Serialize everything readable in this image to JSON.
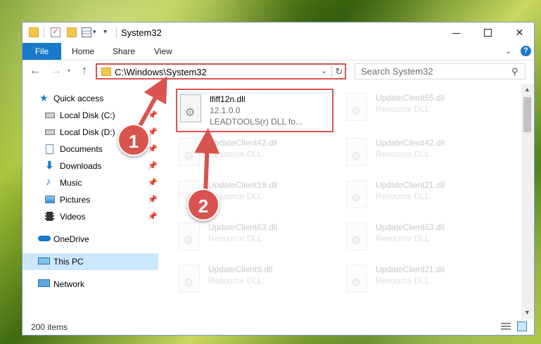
{
  "window": {
    "title": "System32"
  },
  "ribbon": {
    "tabs": [
      "File",
      "Home",
      "Share",
      "View"
    ]
  },
  "address": {
    "path": "C:\\Windows\\System32"
  },
  "search": {
    "placeholder": "Search System32"
  },
  "sidebar": {
    "items": [
      {
        "label": "Quick access",
        "icon": "star-icon"
      },
      {
        "label": "Local Disk (C:)",
        "icon": "drive-icon",
        "pinned": true
      },
      {
        "label": "Local Disk (D:)",
        "icon": "drive-icon",
        "pinned": true
      },
      {
        "label": "Documents",
        "icon": "documents-icon",
        "pinned": true
      },
      {
        "label": "Downloads",
        "icon": "download-icon",
        "pinned": true
      },
      {
        "label": "Music",
        "icon": "music-icon",
        "pinned": true
      },
      {
        "label": "Pictures",
        "icon": "pictures-icon",
        "pinned": true
      },
      {
        "label": "Videos",
        "icon": "videos-icon",
        "pinned": true
      },
      {
        "label": "OneDrive",
        "icon": "cloud-icon"
      },
      {
        "label": "This PC",
        "icon": "computer-icon",
        "selected": true
      },
      {
        "label": "Network",
        "icon": "network-icon"
      }
    ]
  },
  "files": [
    {
      "name": "lfiff12n.dll",
      "line2": "12.1.0.0",
      "line3": "LEADTOOLS(r) DLL fo...",
      "highlighted": true
    },
    {
      "name": "UpdateClient65.dll",
      "line2": "Resource DLL"
    },
    {
      "name": "UpdateClient42.dll",
      "line2": "Resource DLL"
    },
    {
      "name": "UpdateClient42.dll",
      "line2": "Resource DLL"
    },
    {
      "name": "UpdateClient19.dll",
      "line2": "Resource DLL"
    },
    {
      "name": "UpdateClient21.dll",
      "line2": "Resource DLL"
    },
    {
      "name": "UpdateClient63.dll",
      "line2": "Resource DLL"
    },
    {
      "name": "UpdateClient63.dll",
      "line2": "Resource DLL"
    },
    {
      "name": "UpdateClient5.dll",
      "line2": "Resource DLL"
    },
    {
      "name": "UpdateClient21.dll",
      "line2": "Resource DLL"
    }
  ],
  "status": {
    "count": "200 items"
  },
  "callouts": [
    "1",
    "2"
  ],
  "colors": {
    "accent": "#1979ca",
    "highlight": "#d9534f",
    "selected": "#cce8ff"
  }
}
